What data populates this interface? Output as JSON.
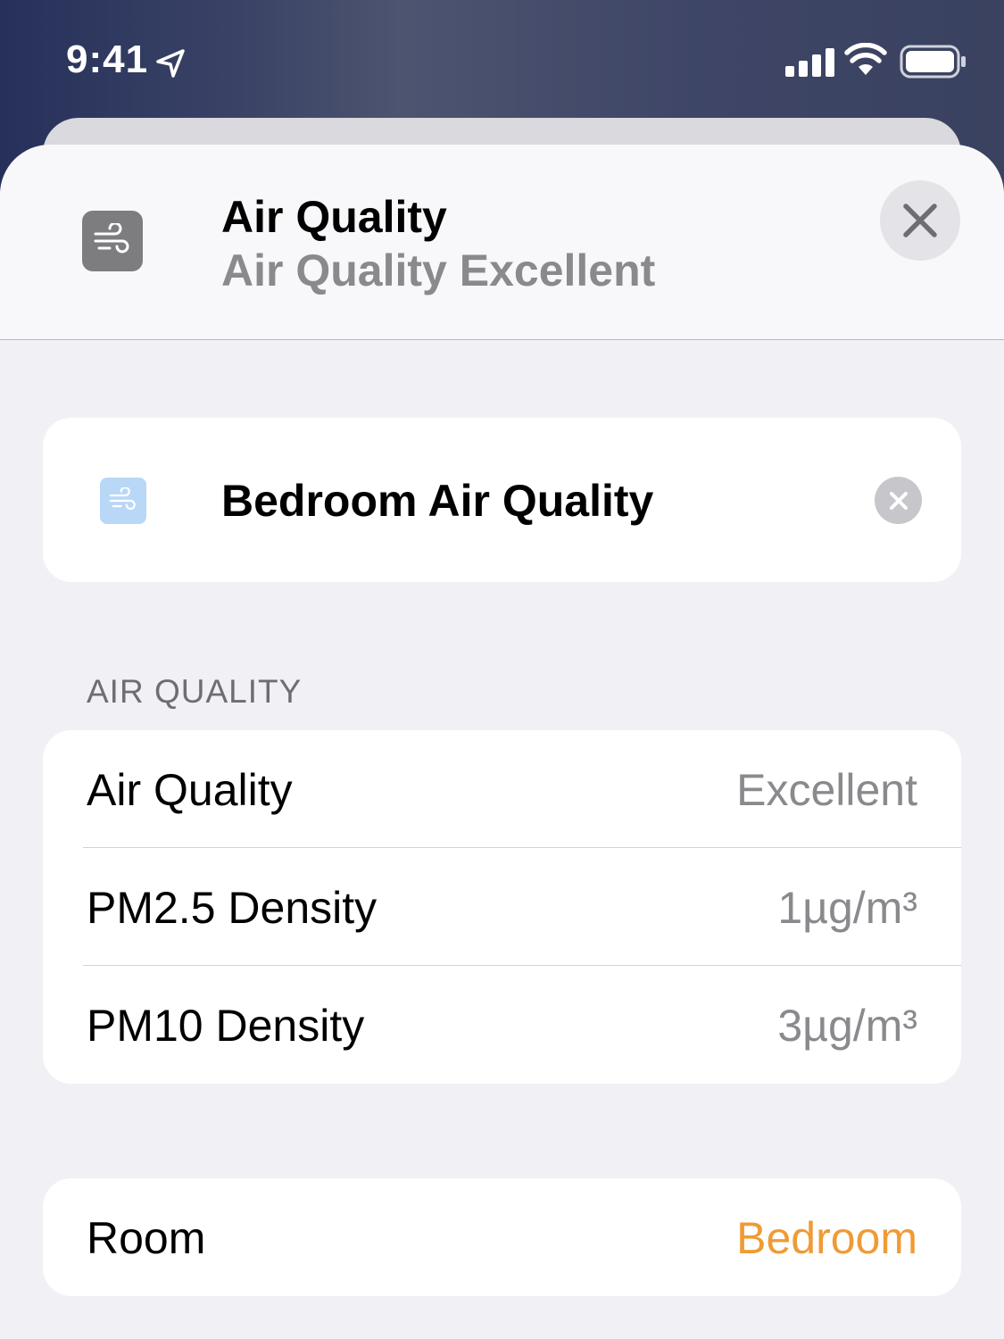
{
  "status_bar": {
    "time": "9:41"
  },
  "header": {
    "title": "Air Quality",
    "subtitle": "Air Quality Excellent",
    "icon": "wind-icon",
    "close_icon": "close-icon"
  },
  "accessory": {
    "name": "Bedroom Air Quality",
    "icon": "wind-icon",
    "clear_icon": "clear-icon"
  },
  "air_quality_section": {
    "label": "AIR QUALITY",
    "rows": [
      {
        "label": "Air Quality",
        "value": "Excellent"
      },
      {
        "label": "PM2.5 Density",
        "value": "1µg/m³"
      },
      {
        "label": "PM10 Density",
        "value": "3µg/m³"
      }
    ]
  },
  "room": {
    "label": "Room",
    "value": "Bedroom"
  },
  "colors": {
    "accent": "#ef9b35",
    "secondary_text": "#8a8a8e",
    "background": "#f1f1f5"
  }
}
